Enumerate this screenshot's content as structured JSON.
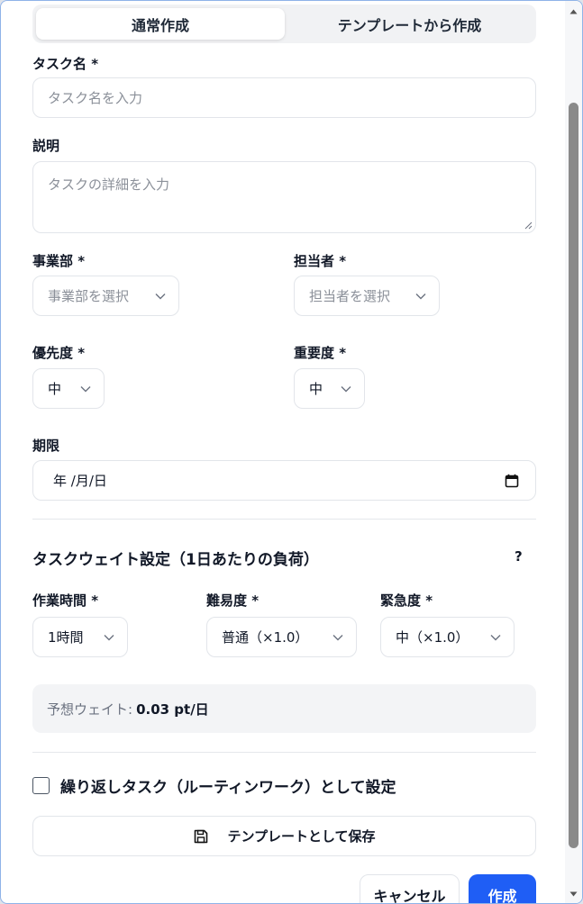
{
  "tabs": [
    {
      "label": "通常作成",
      "active": true
    },
    {
      "label": "テンプレートから作成",
      "active": false
    }
  ],
  "task_name": {
    "label": "タスク名 *",
    "placeholder": "タスク名を入力"
  },
  "description": {
    "label": "説明",
    "placeholder": "タスクの詳細を入力"
  },
  "department": {
    "label": "事業部 *",
    "placeholder": "事業部を選択"
  },
  "assignee": {
    "label": "担当者 *",
    "placeholder": "担当者を選択"
  },
  "priority": {
    "label": "優先度 *",
    "value": "中"
  },
  "importance": {
    "label": "重要度 *",
    "value": "中"
  },
  "deadline": {
    "label": "期限",
    "value": "年 /月/日"
  },
  "weight_section": {
    "title": "タスクウェイト設定（1日あたりの負荷）",
    "help": "?",
    "work_time": {
      "label": "作業時間 *",
      "value": "1時間"
    },
    "difficulty": {
      "label": "難易度 *",
      "value": "普通（×1.0）"
    },
    "urgency": {
      "label": "緊急度 *",
      "value": "中（×1.0）"
    },
    "estimate_label": "予想ウェイト:",
    "estimate_value": "0.03 pt/日"
  },
  "recurring": {
    "label": "繰り返しタスク（ルーティンワーク）として設定",
    "checked": false
  },
  "save_template": {
    "label": "テンプレートとして保存",
    "icon": "save-icon"
  },
  "actions": {
    "cancel": "キャンセル",
    "create": "作成"
  },
  "colors": {
    "primary": "#1f5ef5",
    "border": "#e2e5ea",
    "muted_bg": "#f3f4f6"
  }
}
